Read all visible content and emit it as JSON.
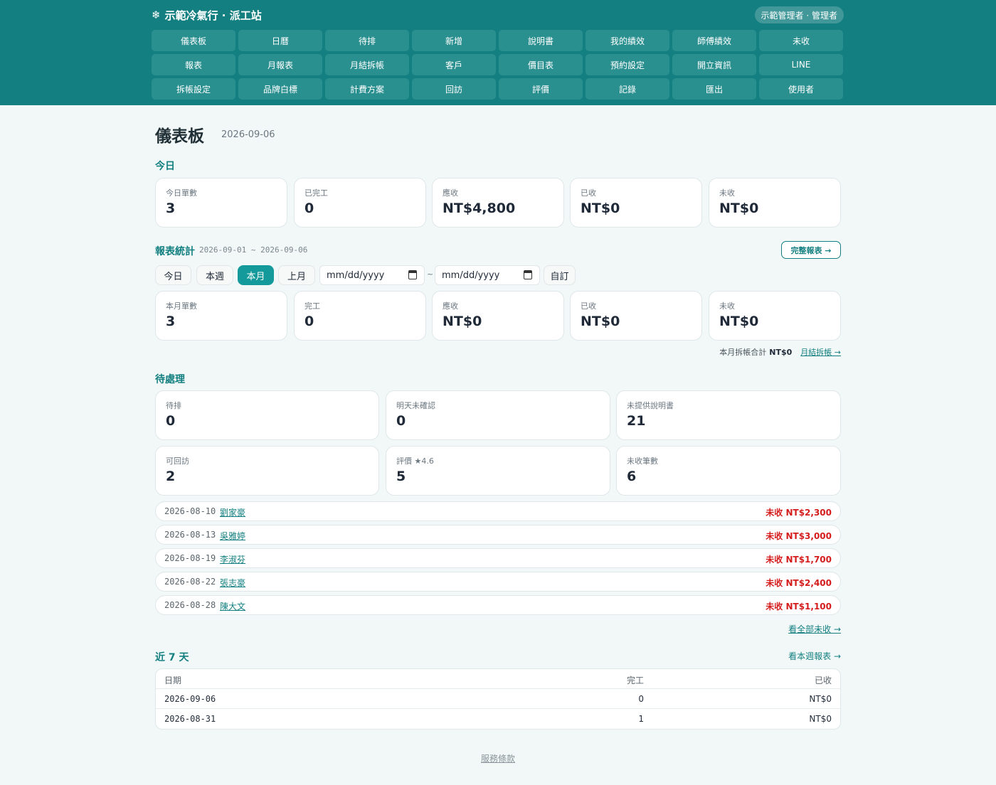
{
  "header": {
    "brand": "示範冷氣行 · 派工站",
    "user": "示範管理者 · 管理者",
    "nav": [
      "儀表板",
      "日曆",
      "待排",
      "新增",
      "說明書",
      "我的績效",
      "師傅績效",
      "未收",
      "報表",
      "月報表",
      "月結拆帳",
      "客戶",
      "價目表",
      "預約設定",
      "開立資訊",
      "LINE",
      "拆帳設定",
      "品牌白標",
      "計費方案",
      "回訪",
      "評價",
      "記錄",
      "匯出",
      "使用者"
    ]
  },
  "page": {
    "title": "儀表板",
    "date": "2026-09-06"
  },
  "today": {
    "heading": "今日",
    "cards": [
      {
        "label": "今日單數",
        "value": "3"
      },
      {
        "label": "已完工",
        "value": "0"
      },
      {
        "label": "應收",
        "value": "NT$4,800"
      },
      {
        "label": "已收",
        "value": "NT$0"
      },
      {
        "label": "未收",
        "value": "NT$0"
      }
    ]
  },
  "report": {
    "heading": "報表統計",
    "range": "2026-09-01 ~ 2026-09-06",
    "full_report": "完整報表 →",
    "chips": [
      "今日",
      "本週",
      "本月",
      "上月"
    ],
    "active_chip": "本月",
    "date_placeholder": "mm/dd/yyyy",
    "tilde": "~",
    "custom": "自訂",
    "cards": [
      {
        "label": "本月單數",
        "value": "3"
      },
      {
        "label": "完工",
        "value": "0"
      },
      {
        "label": "應收",
        "value": "NT$0"
      },
      {
        "label": "已收",
        "value": "NT$0"
      },
      {
        "label": "未收",
        "value": "NT$0"
      }
    ],
    "monthly_label": "本月拆帳合計",
    "monthly_total": "NT$0",
    "monthly_link": "月結拆帳 →"
  },
  "pending": {
    "heading": "待處理",
    "cards": [
      {
        "label": "待排",
        "value": "0"
      },
      {
        "label": "明天未確認",
        "value": "0"
      },
      {
        "label": "未提供說明書",
        "value": "21"
      },
      {
        "label": "可回訪",
        "value": "2"
      },
      {
        "label": "評價 ★4.6",
        "value": "5"
      },
      {
        "label": "未收筆數",
        "value": "6"
      }
    ],
    "unpaid": [
      {
        "date": "2026-08-10",
        "name": "劉家豪",
        "amount": "未收 NT$2,300"
      },
      {
        "date": "2026-08-13",
        "name": "吳雅婷",
        "amount": "未收 NT$3,000"
      },
      {
        "date": "2026-08-19",
        "name": "李淑芬",
        "amount": "未收 NT$1,700"
      },
      {
        "date": "2026-08-22",
        "name": "張志豪",
        "amount": "未收 NT$2,400"
      },
      {
        "date": "2026-08-28",
        "name": "陳大文",
        "amount": "未收 NT$1,100"
      }
    ],
    "view_all": "看全部未收 →"
  },
  "recent": {
    "heading": "近 7 天",
    "week_link": "看本週報表 →",
    "columns": [
      "日期",
      "完工",
      "已收"
    ],
    "rows": [
      {
        "date": "2026-09-06",
        "done": "0",
        "paid": "NT$0"
      },
      {
        "date": "2026-08-31",
        "done": "1",
        "paid": "NT$0"
      }
    ]
  },
  "footer": {
    "terms": "服務條款"
  },
  "colors": {
    "accent": "#137f80",
    "nav_button": "#2a8f8f",
    "danger": "#d51c1c",
    "background": "#f2f8f8"
  }
}
